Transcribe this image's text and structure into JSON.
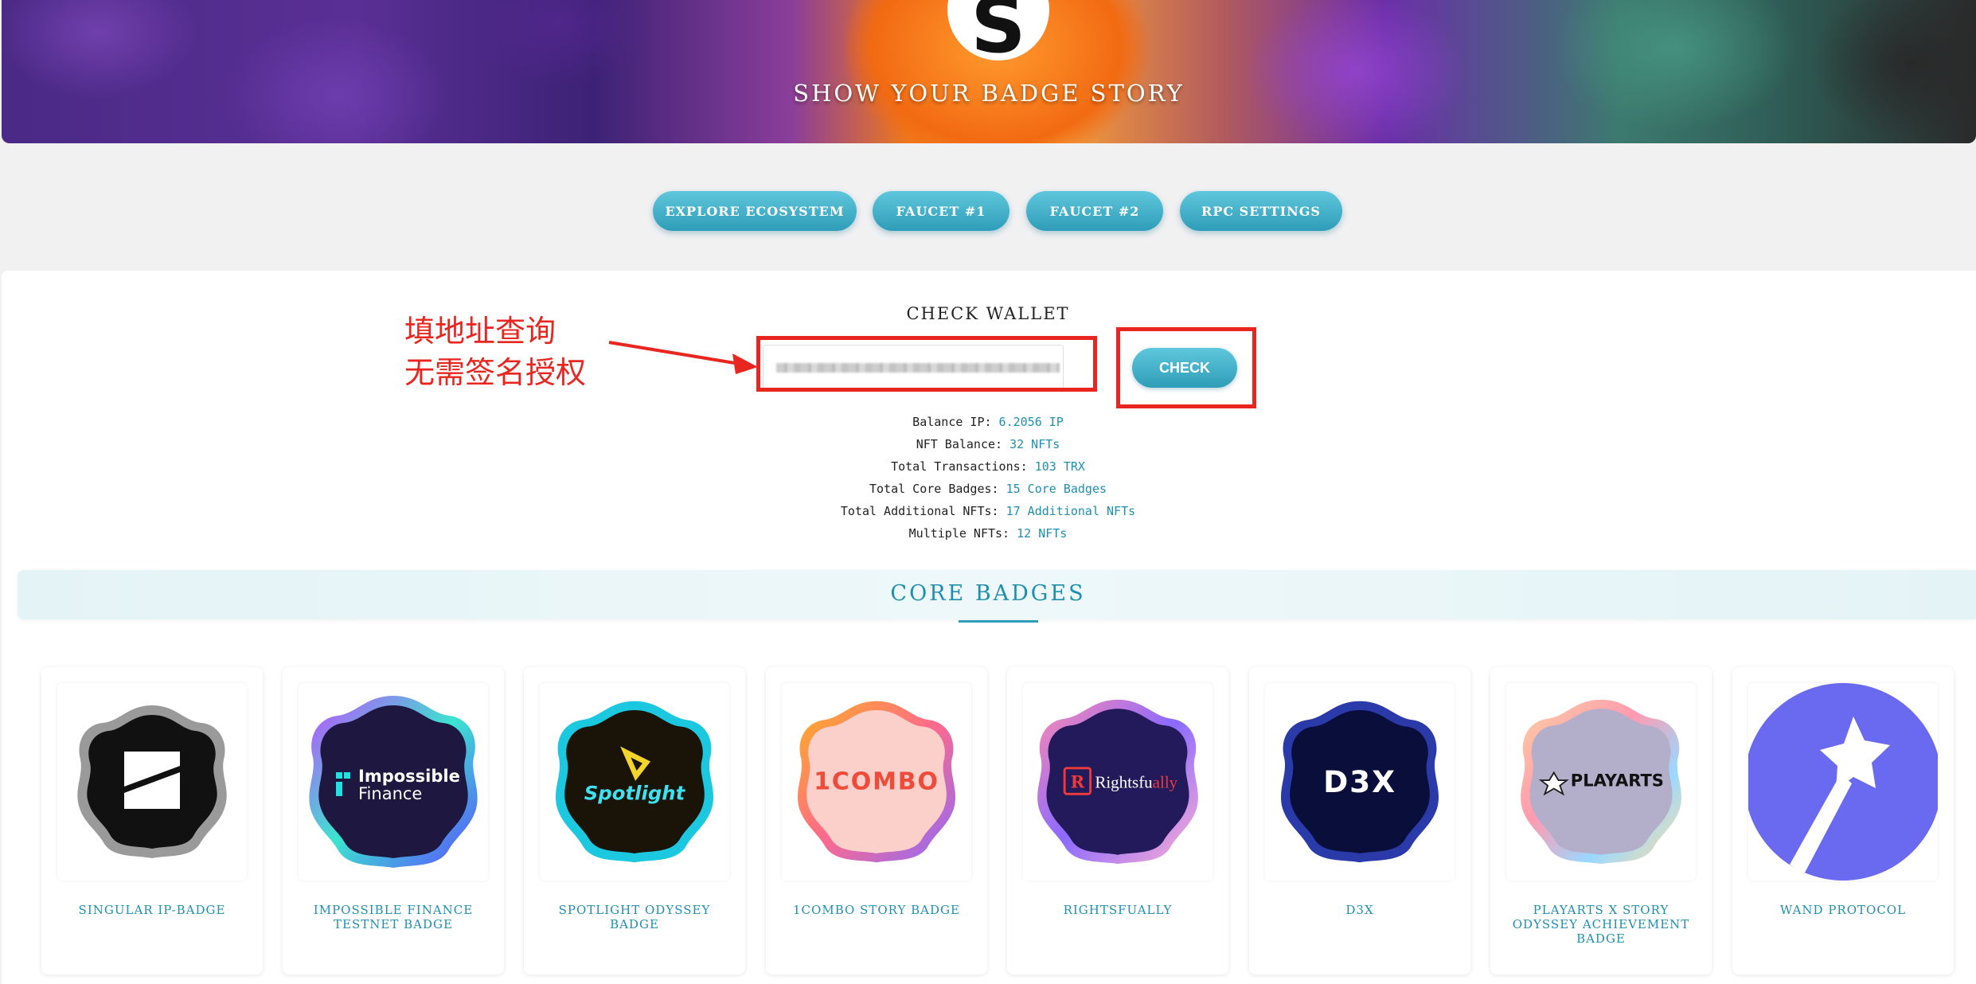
{
  "hero": {
    "logo_letter": "S",
    "title": "SHOW YOUR BADGE STORY"
  },
  "nav": [
    {
      "label": "EXPLORE ECOSYSTEM"
    },
    {
      "label": "FAUCET #1"
    },
    {
      "label": "FAUCET #2"
    },
    {
      "label": "RPC SETTINGS"
    }
  ],
  "wallet": {
    "title": "CHECK WALLET",
    "input_value": "",
    "check_label": "CHECK",
    "annotation_line1": "填地址查询",
    "annotation_line2": "无需签名授权"
  },
  "stats": [
    {
      "label": "Balance IP:",
      "value": "6.2056 IP"
    },
    {
      "label": "NFT Balance:",
      "value": "32 NFTs"
    },
    {
      "label": "Total Transactions:",
      "value": "103 TRX"
    },
    {
      "label": "Total Core Badges:",
      "value": "15 Core Badges"
    },
    {
      "label": "Total Additional NFTs:",
      "value": "17 Additional NFTs"
    },
    {
      "label": "Multiple NFTs:",
      "value": "12 NFTs"
    }
  ],
  "core": {
    "title": "CORE BADGES"
  },
  "badges": [
    {
      "name": "SINGULAR IP-BADGE",
      "art": ""
    },
    {
      "name": "IMPOSSIBLE FINANCE TESTNET BADGE",
      "art": "Impossible Finance"
    },
    {
      "name": "SPOTLIGHT ODYSSEY BADGE",
      "art": "Spotlight"
    },
    {
      "name": "1COMBO STORY BADGE",
      "art": "1COMBO"
    },
    {
      "name": "RIGHTSFUALLY",
      "art": "Rightsfually"
    },
    {
      "name": "D3X",
      "art": "D3X"
    },
    {
      "name": "PLAYARTS X STORY ODYSSEY ACHIEVEMENT BADGE",
      "art": "PLAYARTS"
    },
    {
      "name": "WAND PROTOCOL",
      "art": ""
    }
  ],
  "colors": {
    "accent": "#2f9db8",
    "link": "#1f8fb0",
    "annotation": "#e8261f"
  }
}
